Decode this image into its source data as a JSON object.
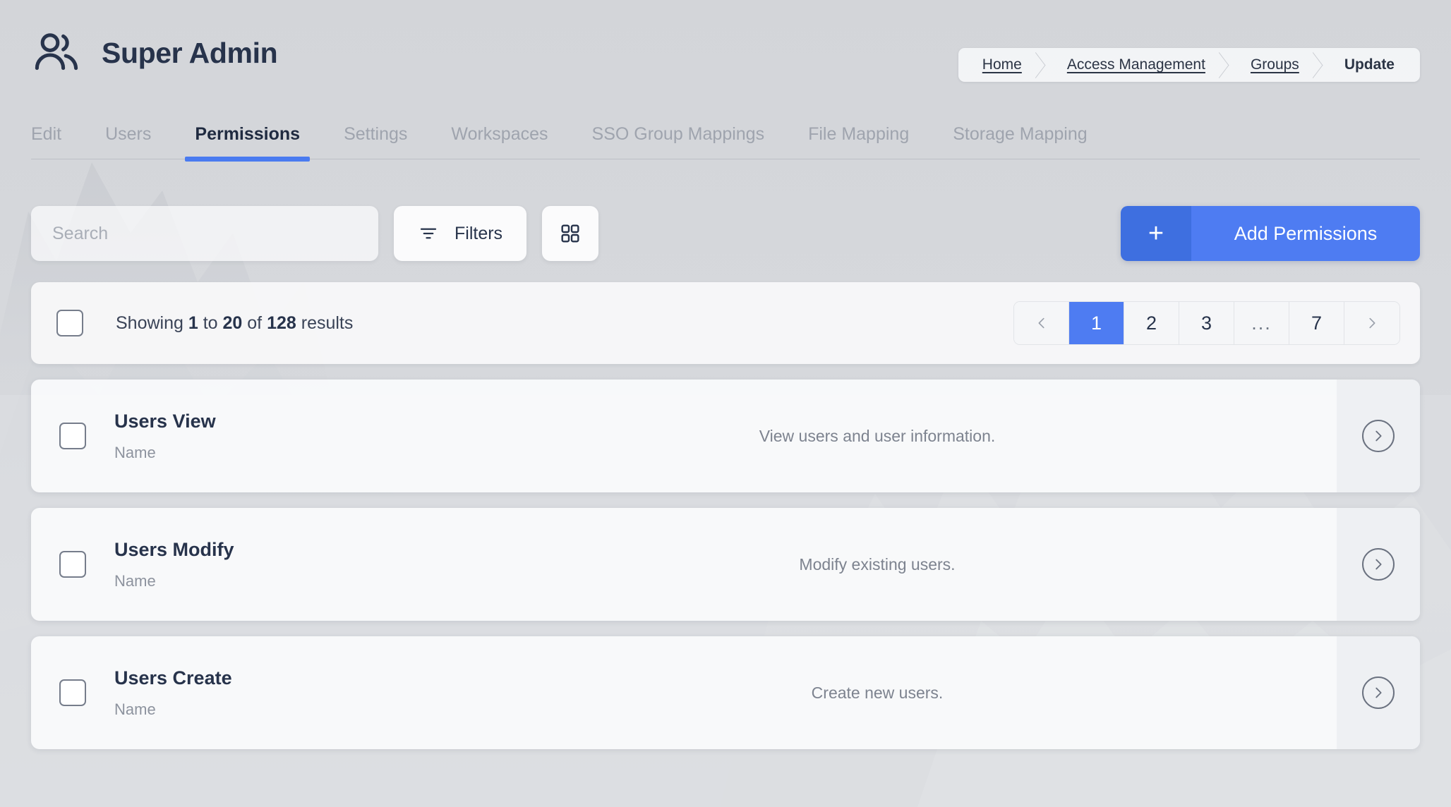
{
  "header": {
    "icon": "users-icon",
    "title": "Super Admin"
  },
  "breadcrumb": [
    {
      "label": "Home",
      "current": false
    },
    {
      "label": "Access Management",
      "current": false
    },
    {
      "label": "Groups",
      "current": false
    },
    {
      "label": "Update",
      "current": true
    }
  ],
  "tabs": [
    {
      "label": "Edit",
      "active": false
    },
    {
      "label": "Users",
      "active": false
    },
    {
      "label": "Permissions",
      "active": true
    },
    {
      "label": "Settings",
      "active": false
    },
    {
      "label": "Workspaces",
      "active": false
    },
    {
      "label": "SSO Group Mappings",
      "active": false
    },
    {
      "label": "File Mapping",
      "active": false
    },
    {
      "label": "Storage Mapping",
      "active": false
    }
  ],
  "toolbar": {
    "search_placeholder": "Search",
    "search_value": "",
    "filters_label": "Filters",
    "filters_icon": "filter-icon",
    "grid_view_icon": "grid-view-icon",
    "add_plus": "+",
    "add_label": "Add Permissions"
  },
  "results": {
    "prefix": "Showing ",
    "from": "1",
    "mid1": " to ",
    "to": "20",
    "mid2": " of ",
    "total": "128",
    "suffix": " results"
  },
  "pagination": {
    "prev_icon": "chevron-left-icon",
    "next_icon": "chevron-right-icon",
    "pages": [
      {
        "label": "1",
        "active": true
      },
      {
        "label": "2",
        "active": false
      },
      {
        "label": "3",
        "active": false
      },
      {
        "label": "...",
        "active": false,
        "dots": true
      },
      {
        "label": "7",
        "active": false
      }
    ]
  },
  "rows": [
    {
      "title": "Users View",
      "sublabel": "Name",
      "description": "View users and user information.",
      "action_icon": "chevron-right-circle-icon"
    },
    {
      "title": "Users Modify",
      "sublabel": "Name",
      "description": "Modify existing users.",
      "action_icon": "chevron-right-circle-icon"
    },
    {
      "title": "Users Create",
      "sublabel": "Name",
      "description": "Create new users.",
      "action_icon": "chevron-right-circle-icon"
    }
  ],
  "colors": {
    "accent": "#4e7cf2",
    "accent_dark": "#3e6fe0",
    "page_bg": "#d5d7db",
    "text_dark": "#27334b",
    "text_muted": "#8d939e"
  }
}
